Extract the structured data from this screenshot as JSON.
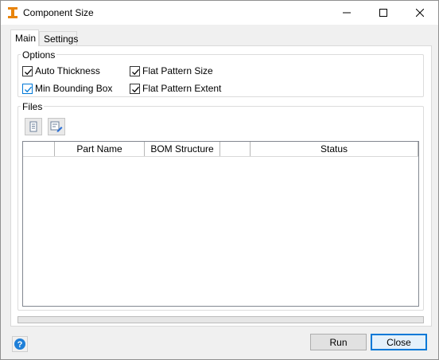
{
  "window": {
    "title": "Component Size"
  },
  "tabs": [
    {
      "label": "Main",
      "active": true
    },
    {
      "label": "Settings",
      "active": false
    }
  ],
  "options": {
    "group_label": "Options",
    "checkboxes": [
      {
        "label": "Auto Thickness",
        "checked": true
      },
      {
        "label": "Min Bounding Box",
        "checked": true
      },
      {
        "label": "Flat Pattern Size",
        "checked": true
      },
      {
        "label": "Flat Pattern Extent",
        "checked": true
      }
    ]
  },
  "files": {
    "group_label": "Files",
    "toolbar_icons": [
      "list-document-icon",
      "edit-list-icon"
    ],
    "columns": [
      "",
      "Part Name",
      "BOM Structure",
      "",
      "Status"
    ],
    "rows": []
  },
  "progress": {
    "value": 0
  },
  "footer": {
    "help_icon": "help-icon",
    "run_label": "Run",
    "close_label": "Close"
  },
  "colors": {
    "accent": "#0078d7",
    "app_icon": "#e8840c"
  }
}
